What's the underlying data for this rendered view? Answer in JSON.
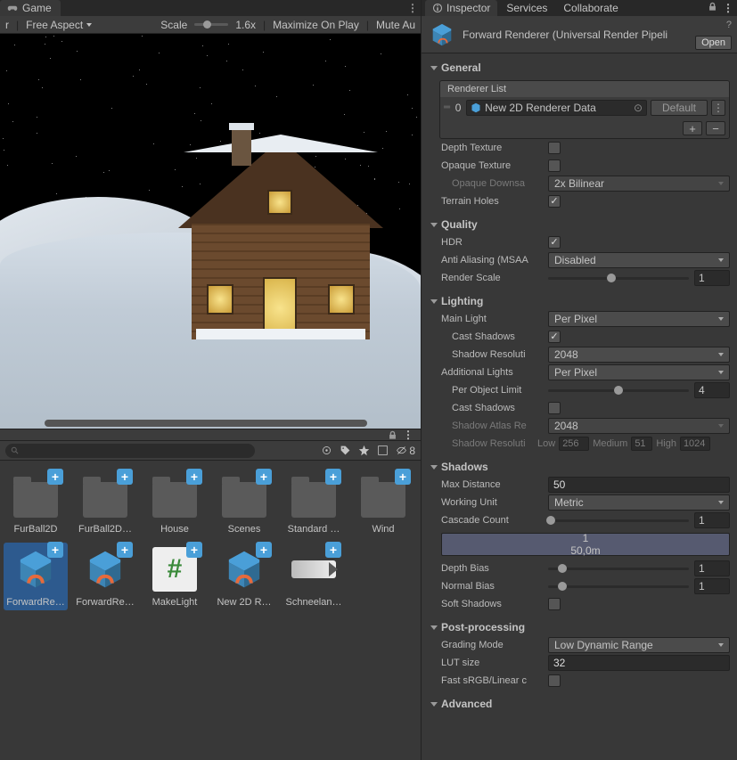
{
  "gameTab": {
    "label": "Game"
  },
  "gameToolbar": {
    "rLabel": "r",
    "aspect": "Free Aspect",
    "scaleLabel": "Scale",
    "scaleValue": "1.6x",
    "maximize": "Maximize On Play",
    "muteAudio": "Mute Au"
  },
  "projectBar": {
    "hiddenCount": "8"
  },
  "assets": [
    {
      "name": "FurBall2D",
      "type": "folder"
    },
    {
      "name": "FurBall2D…",
      "type": "folder"
    },
    {
      "name": "House",
      "type": "folder"
    },
    {
      "name": "Scenes",
      "type": "folder"
    },
    {
      "name": "Standard …",
      "type": "folder"
    },
    {
      "name": "Wind",
      "type": "folder"
    },
    {
      "name": "ForwardRe…",
      "type": "urp-asset",
      "selected": true
    },
    {
      "name": "ForwardRe…",
      "type": "urp-asset"
    },
    {
      "name": "MakeLight",
      "type": "script"
    },
    {
      "name": "New 2D R…",
      "type": "urp-asset"
    },
    {
      "name": "Schneelan…",
      "type": "anim"
    }
  ],
  "inspectorTabs": [
    "Inspector",
    "Services",
    "Collaborate"
  ],
  "inspector": {
    "title": "Forward Renderer (Universal Render Pipeli",
    "openLabel": "Open",
    "general": {
      "header": "General",
      "rendererListLabel": "Renderer List",
      "rendererIndex": "0",
      "rendererItem": "New 2D Renderer Data",
      "defaultLabel": "Default",
      "depthTexture": {
        "label": "Depth Texture",
        "checked": false
      },
      "opaqueTexture": {
        "label": "Opaque Texture",
        "checked": false
      },
      "opaqueDownsampling": {
        "label": "Opaque Downsa",
        "value": "2x Bilinear"
      },
      "terrainHoles": {
        "label": "Terrain Holes",
        "checked": true
      }
    },
    "quality": {
      "header": "Quality",
      "hdr": {
        "label": "HDR",
        "checked": true
      },
      "antiAliasing": {
        "label": "Anti Aliasing (MSAA",
        "value": "Disabled"
      },
      "renderScale": {
        "label": "Render Scale",
        "value": "1",
        "pos": 45
      }
    },
    "lighting": {
      "header": "Lighting",
      "mainLight": {
        "label": "Main Light",
        "value": "Per Pixel"
      },
      "castShadows": {
        "label": "Cast Shadows",
        "checked": true
      },
      "shadowResolution": {
        "label": "Shadow Resoluti",
        "value": "2048"
      },
      "additionalLights": {
        "label": "Additional Lights",
        "value": "Per Pixel"
      },
      "perObjectLimit": {
        "label": "Per Object Limit",
        "value": "4",
        "pos": 50
      },
      "castShadows2": {
        "label": "Cast Shadows",
        "checked": false
      },
      "shadowAtlas": {
        "label": "Shadow Atlas Re",
        "value": "2048"
      },
      "shadowResTiers": {
        "label": "Shadow Resoluti",
        "low": "Low",
        "lowVal": "256",
        "med": "Medium",
        "medVal": "51",
        "high": "High",
        "highVal": "1024"
      }
    },
    "shadows": {
      "header": "Shadows",
      "maxDistance": {
        "label": "Max Distance",
        "value": "50"
      },
      "workingUnit": {
        "label": "Working Unit",
        "value": "Metric"
      },
      "cascadeCount": {
        "label": "Cascade Count",
        "value": "1",
        "pos": 2
      },
      "cascadeBar": {
        "num": "1",
        "dist": "50,0m"
      },
      "depthBias": {
        "label": "Depth Bias",
        "value": "1",
        "pos": 10
      },
      "normalBias": {
        "label": "Normal Bias",
        "value": "1",
        "pos": 10
      },
      "softShadows": {
        "label": "Soft Shadows",
        "checked": false
      }
    },
    "postProcessing": {
      "header": "Post-processing",
      "gradingMode": {
        "label": "Grading Mode",
        "value": "Low Dynamic Range"
      },
      "lutSize": {
        "label": "LUT size",
        "value": "32"
      },
      "fastSRGB": {
        "label": "Fast sRGB/Linear c",
        "checked": false
      }
    },
    "advanced": {
      "header": "Advanced"
    }
  }
}
